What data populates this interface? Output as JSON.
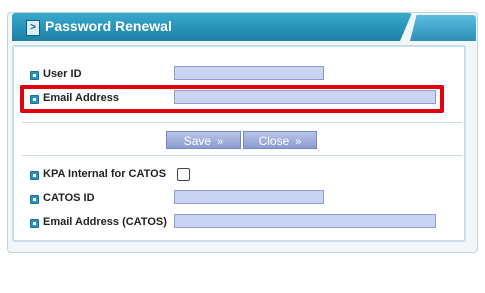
{
  "window": {
    "title": "Password Renewal",
    "tab_arrow": ">"
  },
  "form": {
    "user_id": {
      "label": "User ID",
      "value": ""
    },
    "email": {
      "label": "Email Address",
      "value": ""
    },
    "kpa_internal": {
      "label": "KPA Internal for CATOS",
      "checked": false
    },
    "catos_id": {
      "label": "CATOS ID",
      "value": ""
    },
    "catos_email": {
      "label": "Email Address (CATOS)",
      "value": ""
    }
  },
  "buttons": {
    "save": "Save",
    "close": "Close",
    "chevron": "»"
  },
  "colors": {
    "header": "#1d7fa6",
    "input_fill": "#c9d4f2",
    "highlight": "#e3000f"
  }
}
